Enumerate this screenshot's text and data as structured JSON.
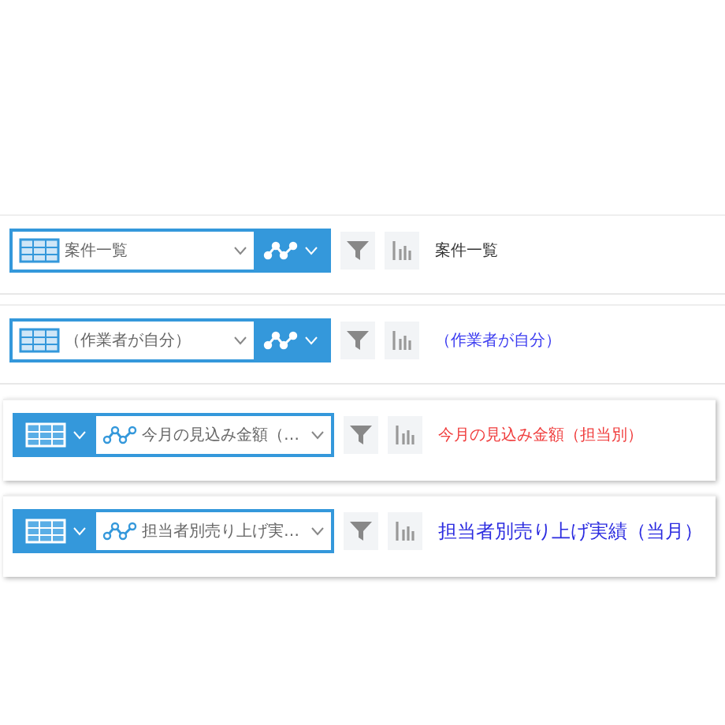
{
  "rows": [
    {
      "kind": "view-first",
      "field": "案件一覧",
      "title": "案件一覧",
      "color": "#333333",
      "large_title": false
    },
    {
      "kind": "view-first",
      "field": "（作業者が自分）",
      "title": "（作業者が自分）",
      "color": "#3b3bf0",
      "large_title": false
    },
    {
      "kind": "chart-first",
      "field": "今月の見込み金額（…",
      "title": "今月の見込み金額（担当別）",
      "color": "#f03c3c",
      "large_title": false
    },
    {
      "kind": "chart-first",
      "field": "担当者別売り上げ実…",
      "title": "担当者別売り上げ実績（当月）",
      "color": "#2b2be0",
      "large_title": true
    }
  ]
}
